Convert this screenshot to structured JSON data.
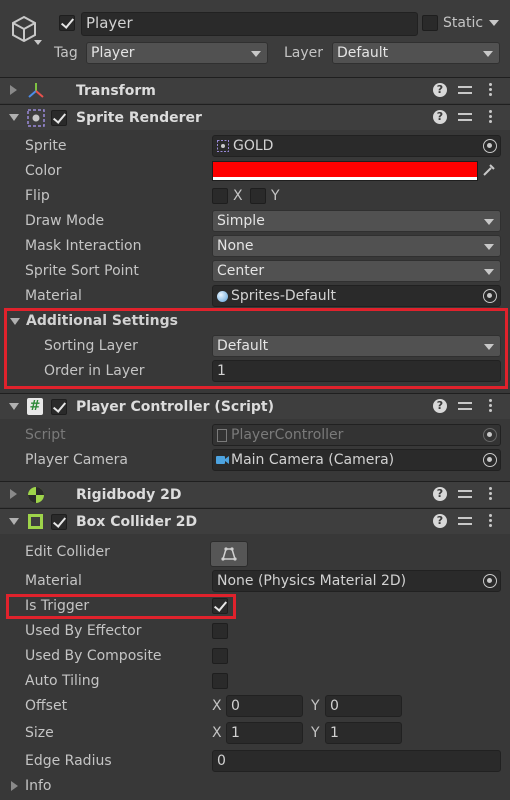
{
  "header": {
    "object_name": "Player",
    "static_label": "Static",
    "tag_label": "Tag",
    "tag_value": "Player",
    "layer_label": "Layer",
    "layer_value": "Default"
  },
  "components": {
    "transform": {
      "title": "Transform"
    },
    "sprite_renderer": {
      "title": "Sprite Renderer",
      "rows": {
        "sprite_label": "Sprite",
        "sprite_value": "GOLD",
        "color_label": "Color",
        "flip_label": "Flip",
        "flip_x": "X",
        "flip_y": "Y",
        "draw_mode_label": "Draw Mode",
        "draw_mode_value": "Simple",
        "mask_label": "Mask Interaction",
        "mask_value": "None",
        "sort_point_label": "Sprite Sort Point",
        "sort_point_value": "Center",
        "material_label": "Material",
        "material_value": "Sprites-Default"
      },
      "additional": {
        "title": "Additional Settings",
        "sorting_layer_label": "Sorting Layer",
        "sorting_layer_value": "Default",
        "order_label": "Order in Layer",
        "order_value": "1"
      },
      "color_value": "#ff0000"
    },
    "player_controller": {
      "title": "Player Controller (Script)",
      "script_label": "Script",
      "script_value": "PlayerController",
      "camera_label": "Player Camera",
      "camera_value": "Main Camera (Camera)"
    },
    "rigidbody": {
      "title": "Rigidbody 2D"
    },
    "box_collider": {
      "title": "Box Collider 2D",
      "edit_collider_label": "Edit Collider",
      "material_label": "Material",
      "material_value": "None (Physics Material 2D)",
      "is_trigger_label": "Is Trigger",
      "is_trigger_checked": true,
      "used_by_effector_label": "Used By Effector",
      "used_by_composite_label": "Used By Composite",
      "auto_tiling_label": "Auto Tiling",
      "offset_label": "Offset",
      "offset_x_label": "X",
      "offset_x": "0",
      "offset_y_label": "Y",
      "offset_y": "0",
      "size_label": "Size",
      "size_x_label": "X",
      "size_x": "1",
      "size_y_label": "Y",
      "size_y": "1",
      "edge_radius_label": "Edge Radius",
      "edge_radius_value": "0"
    }
  },
  "info": {
    "label": "Info"
  },
  "icons": {
    "help": "?",
    "highlight_color": "#e0222c"
  }
}
